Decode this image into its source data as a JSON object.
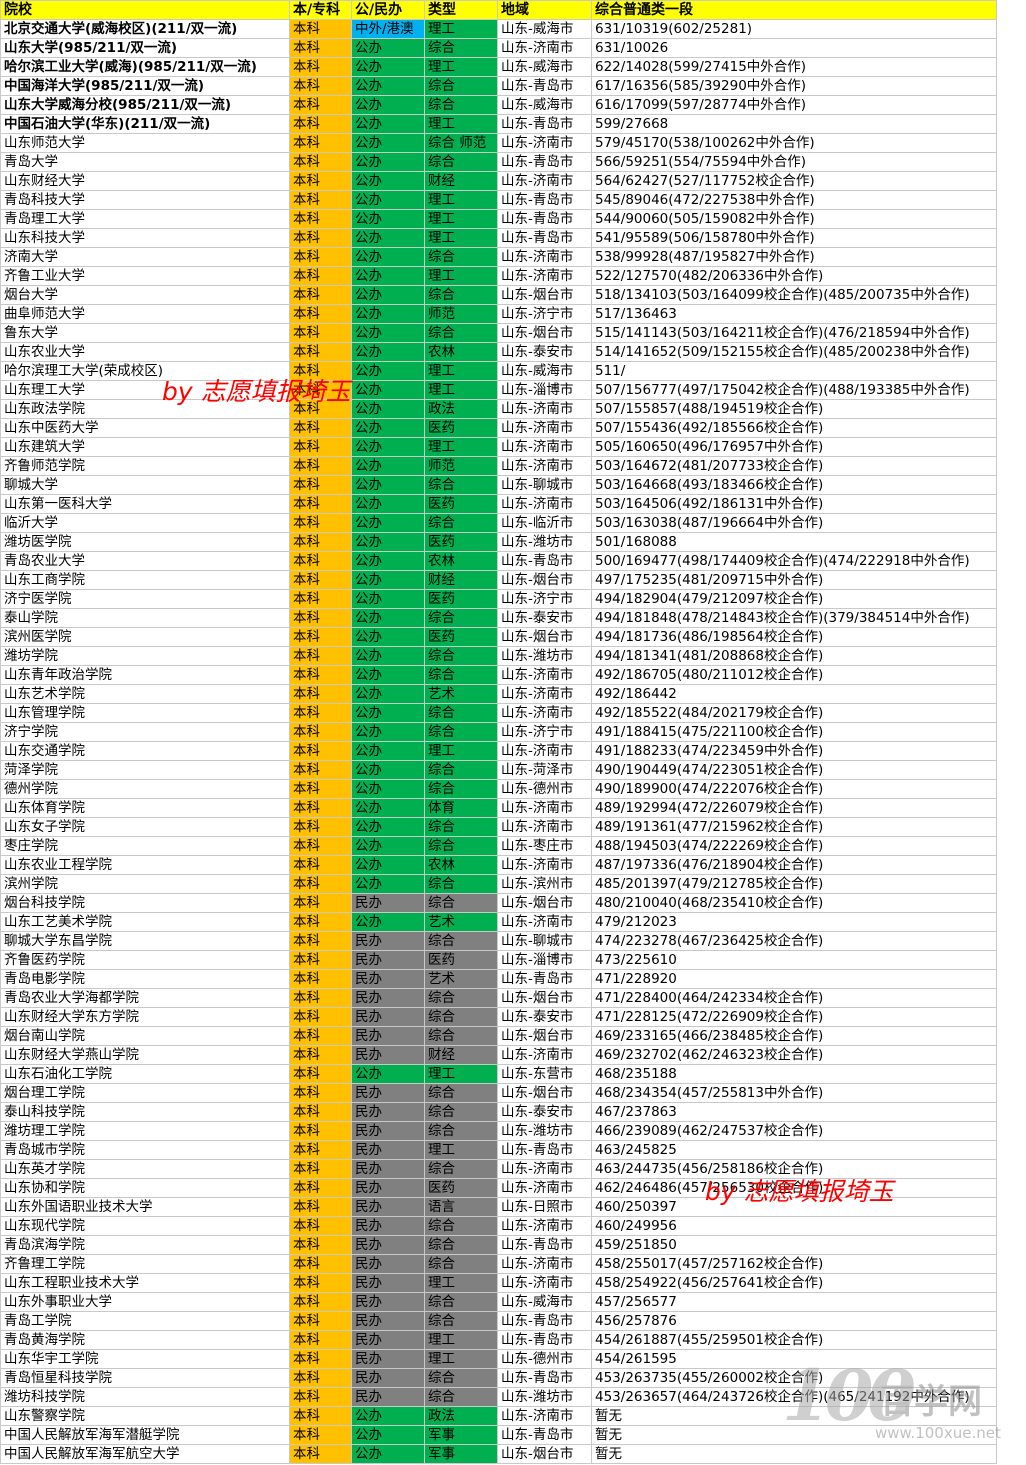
{
  "headers": [
    "院校",
    "本/专科",
    "公/民办",
    "类型",
    "地域",
    "综合普通类一段"
  ],
  "colors": {
    "header": "#ffff00",
    "level": "#ffc000",
    "public": "#00b050",
    "private": "#808080",
    "sino_foreign": "#00b0f0"
  },
  "watermarks": [
    "by 志愿填报埼玉",
    "by 志愿填报埼玉"
  ],
  "logo": {
    "number": "100",
    "name": "百学网",
    "url": "www.100xue.net"
  },
  "rows": [
    [
      "北京交通大学(威海校区)(211/双一流)",
      "本科",
      "中外/港澳",
      "理工",
      "山东-威海市",
      "631/10319(602/25281)"
    ],
    [
      "山东大学(985/211/双一流)",
      "本科",
      "公办",
      "综合",
      "山东-济南市",
      "631/10026"
    ],
    [
      "哈尔滨工业大学(威海)(985/211/双一流)",
      "本科",
      "公办",
      "理工",
      "山东-威海市",
      "622/14028(599/27415中外合作)"
    ],
    [
      "中国海洋大学(985/211/双一流)",
      "本科",
      "公办",
      "综合",
      "山东-青岛市",
      "617/16356(585/39290中外合作)"
    ],
    [
      "山东大学威海分校(985/211/双一流)",
      "本科",
      "公办",
      "综合",
      "山东-威海市",
      "616/17099(597/28774中外合作)"
    ],
    [
      "中国石油大学(华东)(211/双一流)",
      "本科",
      "公办",
      "理工",
      "山东-青岛市",
      "599/27668"
    ],
    [
      "山东师范大学",
      "本科",
      "公办",
      "综合 师范",
      "山东-济南市",
      "579/45170(538/100262中外合作)"
    ],
    [
      "青岛大学",
      "本科",
      "公办",
      "综合",
      "山东-青岛市",
      "566/59251(554/75594中外合作)"
    ],
    [
      "山东财经大学",
      "本科",
      "公办",
      "财经",
      "山东-济南市",
      "564/62427(527/117752校企合作)"
    ],
    [
      "青岛科技大学",
      "本科",
      "公办",
      "理工",
      "山东-青岛市",
      "545/89046(472/227538中外合作)"
    ],
    [
      "青岛理工大学",
      "本科",
      "公办",
      "理工",
      "山东-青岛市",
      "544/90060(505/159082中外合作)"
    ],
    [
      "山东科技大学",
      "本科",
      "公办",
      "理工",
      "山东-青岛市",
      "541/95589(506/158780中外合作)"
    ],
    [
      "济南大学",
      "本科",
      "公办",
      "综合",
      "山东-济南市",
      "538/99928(487/195827中外合作)"
    ],
    [
      "齐鲁工业大学",
      "本科",
      "公办",
      "理工",
      "山东-济南市",
      "522/127570(482/206336中外合作)"
    ],
    [
      "烟台大学",
      "本科",
      "公办",
      "综合",
      "山东-烟台市",
      "518/134103(503/164099校企合作)(485/200735中外合作)"
    ],
    [
      "曲阜师范大学",
      "本科",
      "公办",
      "师范",
      "山东-济宁市",
      "517/136463"
    ],
    [
      "鲁东大学",
      "本科",
      "公办",
      "综合",
      "山东-烟台市",
      "515/141143(503/164211校企合作)(476/218594中外合作)"
    ],
    [
      "山东农业大学",
      "本科",
      "公办",
      "农林",
      "山东-泰安市",
      "514/141652(509/152155校企合作)(485/200238中外合作)"
    ],
    [
      "哈尔滨理工大学(荣成校区)",
      "本科",
      "公办",
      "理工",
      "山东-威海市",
      "511/"
    ],
    [
      "山东理工大学",
      "本科",
      "公办",
      "理工",
      "山东-淄博市",
      "507/156777(497/175042校企合作)(488/193385中外合作)"
    ],
    [
      "山东政法学院",
      "本科",
      "公办",
      "政法",
      "山东-济南市",
      "507/155857(488/194519校企合作)"
    ],
    [
      "山东中医药大学",
      "本科",
      "公办",
      "医药",
      "山东-济南市",
      "507/155436(492/185566校企合作)"
    ],
    [
      "山东建筑大学",
      "本科",
      "公办",
      "理工",
      "山东-济南市",
      "505/160650(496/176957中外合作)"
    ],
    [
      "齐鲁师范学院",
      "本科",
      "公办",
      "师范",
      "山东-济南市",
      "503/164672(481/207733校企合作)"
    ],
    [
      "聊城大学",
      "本科",
      "公办",
      "综合",
      "山东-聊城市",
      "503/164668(493/183466校企合作)"
    ],
    [
      "山东第一医科大学",
      "本科",
      "公办",
      "医药",
      "山东-济南市",
      "503/164506(492/186131中外合作)"
    ],
    [
      "临沂大学",
      "本科",
      "公办",
      "综合",
      "山东-临沂市",
      "503/163038(487/196664中外合作)"
    ],
    [
      "潍坊医学院",
      "本科",
      "公办",
      "医药",
      "山东-潍坊市",
      "501/168088"
    ],
    [
      "青岛农业大学",
      "本科",
      "公办",
      "农林",
      "山东-青岛市",
      "500/169477(498/174409校企合作)(474/222918中外合作)"
    ],
    [
      "山东工商学院",
      "本科",
      "公办",
      "财经",
      "山东-烟台市",
      "497/175235(481/209715中外合作)"
    ],
    [
      "济宁医学院",
      "本科",
      "公办",
      "医药",
      "山东-济宁市",
      "494/182904(479/212097校企合作)"
    ],
    [
      "泰山学院",
      "本科",
      "公办",
      "综合",
      "山东-泰安市",
      "494/181848(478/214843校企合作)(379/384514中外合作)"
    ],
    [
      "滨州医学院",
      "本科",
      "公办",
      "医药",
      "山东-烟台市",
      "494/181736(486/198564校企合作)"
    ],
    [
      "潍坊学院",
      "本科",
      "公办",
      "综合",
      "山东-潍坊市",
      "494/181341(481/208868校企合作)"
    ],
    [
      "山东青年政治学院",
      "本科",
      "公办",
      "综合",
      "山东-济南市",
      "492/186705(480/211012校企合作)"
    ],
    [
      "山东艺术学院",
      "本科",
      "公办",
      "艺术",
      "山东-济南市",
      "492/186442"
    ],
    [
      "山东管理学院",
      "本科",
      "公办",
      "综合",
      "山东-济南市",
      "492/185522(484/202179校企合作)"
    ],
    [
      "济宁学院",
      "本科",
      "公办",
      "综合",
      "山东-济宁市",
      "491/188415(475/221100校企合作)"
    ],
    [
      "山东交通学院",
      "本科",
      "公办",
      "理工",
      "山东-济南市",
      "491/188233(474/223459中外合作)"
    ],
    [
      "菏泽学院",
      "本科",
      "公办",
      "综合",
      "山东-菏泽市",
      "490/190449(474/223051校企合作)"
    ],
    [
      "德州学院",
      "本科",
      "公办",
      "综合",
      "山东-德州市",
      "490/189900(474/222076校企合作)"
    ],
    [
      "山东体育学院",
      "本科",
      "公办",
      "体育",
      "山东-济南市",
      "489/192994(472/226079校企合作)"
    ],
    [
      "山东女子学院",
      "本科",
      "公办",
      "综合",
      "山东-济南市",
      "489/191361(477/215962校企合作)"
    ],
    [
      "枣庄学院",
      "本科",
      "公办",
      "综合",
      "山东-枣庄市",
      "488/194503(474/222269校企合作)"
    ],
    [
      "山东农业工程学院",
      "本科",
      "公办",
      "农林",
      "山东-济南市",
      "487/197336(476/218904校企合作)"
    ],
    [
      "滨州学院",
      "本科",
      "公办",
      "综合",
      "山东-滨州市",
      "485/201397(479/212785校企合作)"
    ],
    [
      "烟台科技学院",
      "本科",
      "民办",
      "综合",
      "山东-烟台市",
      "480/210040(468/235410校企合作)"
    ],
    [
      "山东工艺美术学院",
      "本科",
      "公办",
      "艺术",
      "山东-济南市",
      "479/212023"
    ],
    [
      "聊城大学东昌学院",
      "本科",
      "民办",
      "综合",
      "山东-聊城市",
      "474/223278(467/236425校企合作)"
    ],
    [
      "齐鲁医药学院",
      "本科",
      "民办",
      "医药",
      "山东-淄博市",
      "473/225610"
    ],
    [
      "青岛电影学院",
      "本科",
      "民办",
      "艺术",
      "山东-青岛市",
      "471/228920"
    ],
    [
      "青岛农业大学海都学院",
      "本科",
      "民办",
      "综合",
      "山东-烟台市",
      "471/228400(464/242334校企合作)"
    ],
    [
      "山东财经大学东方学院",
      "本科",
      "民办",
      "综合",
      "山东-泰安市",
      "471/228125(472/226909校企合作)"
    ],
    [
      "烟台南山学院",
      "本科",
      "民办",
      "综合",
      "山东-烟台市",
      "469/233165(466/238485校企合作)"
    ],
    [
      "山东财经大学燕山学院",
      "本科",
      "民办",
      "财经",
      "山东-济南市",
      "469/232702(462/246323校企合作)"
    ],
    [
      "山东石油化工学院",
      "本科",
      "公办",
      "理工",
      "山东-东营市",
      "468/235188"
    ],
    [
      "烟台理工学院",
      "本科",
      "民办",
      "综合",
      "山东-烟台市",
      "468/234354(457/255813中外合作)"
    ],
    [
      "泰山科技学院",
      "本科",
      "民办",
      "综合",
      "山东-泰安市",
      "467/237863"
    ],
    [
      "潍坊理工学院",
      "本科",
      "民办",
      "综合",
      "山东-潍坊市",
      "466/239089(462/247537校企合作)"
    ],
    [
      "青岛城市学院",
      "本科",
      "民办",
      "理工",
      "山东-青岛市",
      "463/245825"
    ],
    [
      "山东英才学院",
      "本科",
      "民办",
      "综合",
      "山东-济南市",
      "463/244735(456/258186校企合作)"
    ],
    [
      "山东协和学院",
      "本科",
      "民办",
      "医药",
      "山东-济南市",
      "462/246486(457/256530校企合作)"
    ],
    [
      "山东外国语职业技术大学",
      "本科",
      "民办",
      "语言",
      "山东-日照市",
      "460/250397"
    ],
    [
      "山东现代学院",
      "本科",
      "民办",
      "综合",
      "山东-济南市",
      "460/249956"
    ],
    [
      "青岛滨海学院",
      "本科",
      "民办",
      "综合",
      "山东-青岛市",
      "459/251850"
    ],
    [
      "齐鲁理工学院",
      "本科",
      "民办",
      "综合",
      "山东-济南市",
      "458/255017(457/257162校企合作)"
    ],
    [
      "山东工程职业技术大学",
      "本科",
      "民办",
      "理工",
      "山东-济南市",
      "458/254922(456/257641校企合作)"
    ],
    [
      "山东外事职业大学",
      "本科",
      "民办",
      "综合",
      "山东-威海市",
      "457/256577"
    ],
    [
      "青岛工学院",
      "本科",
      "民办",
      "综合",
      "山东-青岛市",
      "456/257876"
    ],
    [
      "青岛黄海学院",
      "本科",
      "民办",
      "理工",
      "山东-青岛市",
      "454/261887(455/259501校企合作)"
    ],
    [
      "山东华宇工学院",
      "本科",
      "民办",
      "理工",
      "山东-德州市",
      "454/261595"
    ],
    [
      "青岛恒星科技学院",
      "本科",
      "民办",
      "综合",
      "山东-青岛市",
      "453/263735(455/260002校企合作)"
    ],
    [
      "潍坊科技学院",
      "本科",
      "民办",
      "综合",
      "山东-潍坊市",
      "453/263657(464/243726校企合作)(465/241192中外合作)"
    ],
    [
      "山东警察学院",
      "本科",
      "公办",
      "政法",
      "山东-济南市",
      "暂无"
    ],
    [
      "中国人民解放军海军潜艇学院",
      "本科",
      "公办",
      "军事",
      "山东-青岛市",
      "暂无"
    ],
    [
      "中国人民解放军海军航空大学",
      "本科",
      "公办",
      "军事",
      "山东-烟台市",
      "暂无"
    ]
  ]
}
